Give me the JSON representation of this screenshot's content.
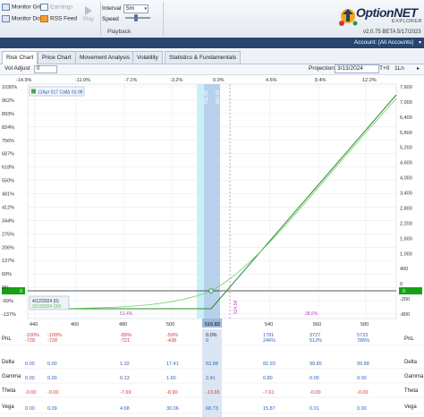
{
  "ribbon": {
    "monitor_grid": "Monitor Grid",
    "monitor_dock": "Monitor Dock",
    "earnings": "Earnings",
    "rss_feed": "RSS Feed",
    "play": "Play",
    "interval_label": "Interval",
    "interval_value": "5m",
    "speed_label": "Speed",
    "group_label": "Playback"
  },
  "logo": {
    "name": "OptionNET",
    "sub": "EXPLORER",
    "version": "v2.0.75 BETA 5/17/2023"
  },
  "account": {
    "label": "Account: [All Accounts]"
  },
  "tabs": [
    "Risk Chart",
    "Price Chart",
    "Movement Analysis",
    "Volatility",
    "Statistics & Fundamentals"
  ],
  "toolbar": {
    "vol_adjust_label": "Vol Adjust",
    "vol_adjust_value": "0",
    "projection_label": "Projection",
    "projection_value": "3/13/2024",
    "tplus": "T+0",
    "step": "1Ln"
  },
  "chart": {
    "top_pct": [
      "-14.9%",
      "-11.0%",
      "-7.1%",
      "-3.2%",
      "0.0%",
      "4.6%",
      "8.4%",
      "12.2%"
    ],
    "left_pct": [
      "1030%",
      "962%",
      "893%",
      "824%",
      "756%",
      "687%",
      "618%",
      "550%",
      "481%",
      "412%",
      "344%",
      "275%",
      "206%",
      "137%",
      "69%",
      "0%",
      "-69%",
      "-137%"
    ],
    "right_vals": [
      "7,600",
      "7,000",
      "6,400",
      "5,800",
      "5,200",
      "4,600",
      "4,000",
      "3,400",
      "2,800",
      "2,200",
      "1,600",
      "1,000",
      "400",
      "0",
      "-200",
      "-800"
    ],
    "x_ticks": [
      "440",
      "460",
      "480",
      "500",
      "516.83",
      "540",
      "560",
      "580"
    ],
    "legend_line1": "12Apr 517 Call",
    "legend_delta_sym": "Δ",
    "legend_delta": "63.98",
    "date_box_line1": "4/12/2024 (0)",
    "date_box_line2": "3/13/2024 (30)",
    "band_label_left": "511.68",
    "band_label_right": "521.42",
    "breakeven_label": "524.58",
    "zero_tag_left": "0",
    "zero_tag_right": "0",
    "pct_left_bottom": "51.4%",
    "pct_right_bottom": "38.6%",
    "colors": {
      "expiration": "#2a8a2a",
      "projection": "#6bd06b",
      "band": "#a8c6e8",
      "cyan": "#c9f0f6"
    }
  },
  "grid": {
    "rows": [
      {
        "label": "PnL",
        "values": [
          "-100%",
          "-100%",
          "-89%",
          "-59%",
          "0.0%",
          "1781",
          "3727",
          "5723"
        ],
        "sub": [
          "-728",
          "-728",
          "-721",
          "-438",
          "0",
          "246%",
          "512%",
          "786%"
        ]
      },
      {
        "label": "Delta",
        "values": [
          "0.00",
          "0.00",
          "1.32",
          "17.41",
          "53.98",
          "82.93",
          "99.85",
          "99.88"
        ]
      },
      {
        "label": "Gamma",
        "values": [
          "0.00",
          "0.00",
          "0.13",
          "1.60",
          "2.41",
          "0.80",
          "0.00",
          "0.00"
        ]
      },
      {
        "label": "Theta",
        "values": [
          "-0.00",
          "-0.00",
          "-7.69",
          "-8.90",
          "-13.65",
          "-7.61",
          "-0.00",
          "-0.00"
        ]
      },
      {
        "label": "Vega",
        "values": [
          "0.00",
          "0.09",
          "4.68",
          "30.06",
          "68.73",
          "15.87",
          "0.01",
          "0.00"
        ]
      }
    ]
  }
}
